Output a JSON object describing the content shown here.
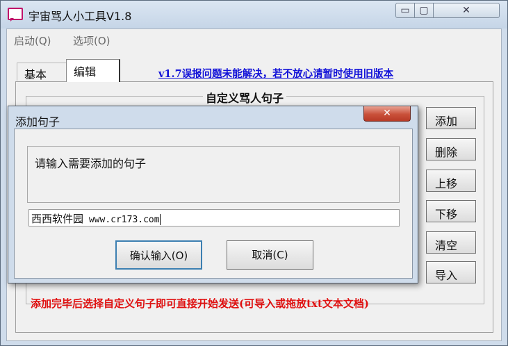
{
  "window": {
    "title": "宇宙骂人小工具V1.8",
    "min_label": "▭",
    "max_label": "▢",
    "close_label": "✕"
  },
  "menu": {
    "items": [
      "启动(Q)",
      "选项(O)"
    ]
  },
  "tabs": {
    "basic": "基本",
    "edit": "编辑"
  },
  "top_link": "v1.7误报问题未能解决，若不放心请暂时使用旧版本",
  "group_title": "自定义骂人句子",
  "side_buttons": [
    "添加",
    "删除",
    "上移",
    "下移",
    "清空",
    "导入"
  ],
  "bottom_note": "添加完毕后选择自定义句子即可直接开始发送(可导入或拖放txt文本文档)",
  "dialog": {
    "title": "添加句子",
    "close_label": "✕",
    "prompt": "请输入需要添加的句子",
    "input_value_cn": "西西软件园",
    "input_value_url": " www.cr173.com",
    "ok_label": "确认输入(O)",
    "cancel_label": "取消(C)"
  }
}
